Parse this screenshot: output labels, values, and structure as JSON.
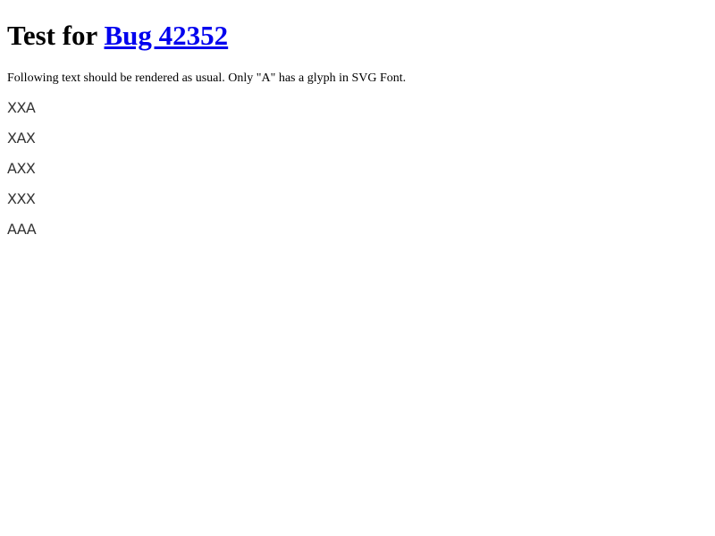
{
  "header": {
    "title_prefix": "Test for ",
    "bug_link": "Bug 42352"
  },
  "description": "Following text should be rendered as usual. Only \"A\" has a glyph in SVG Font.",
  "test_lines": [
    "XXA",
    "XAX",
    "AXX",
    "XXX",
    "AAA"
  ]
}
